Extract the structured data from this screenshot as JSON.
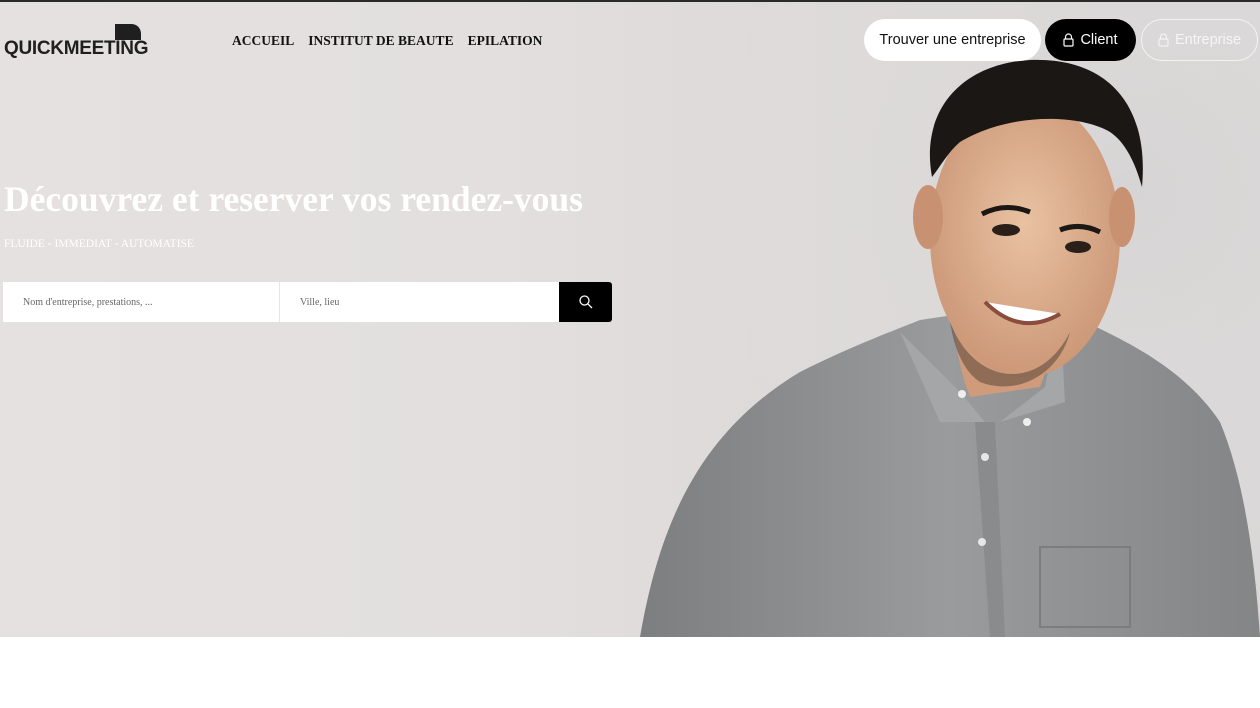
{
  "brand": {
    "name": "QUICKMEETING"
  },
  "nav": {
    "items": [
      {
        "label": "ACCUEIL"
      },
      {
        "label": "INSTITUT DE BEAUTE"
      },
      {
        "label": "EPILATION"
      }
    ]
  },
  "actions": {
    "find_business": "Trouver une entreprise",
    "client": "Client",
    "business": "Entreprise"
  },
  "hero": {
    "title": "Découvrez et reserver vos rendez-vous",
    "subtitle": "FLUIDE - IMMEDIAT - AUTOMATISE"
  },
  "search": {
    "query_placeholder": "Nom d'entreprise, prestations, ...",
    "location_placeholder": "Ville, lieu",
    "query_value": "",
    "location_value": ""
  },
  "icons": {
    "lock": "lock-icon",
    "search": "search-icon",
    "logo_mark": "logo-mark-icon"
  },
  "colors": {
    "primary": "#000000",
    "hero_background": "#e2dfde",
    "hero_text": "#ffffff",
    "shirt": "#8f9091"
  }
}
